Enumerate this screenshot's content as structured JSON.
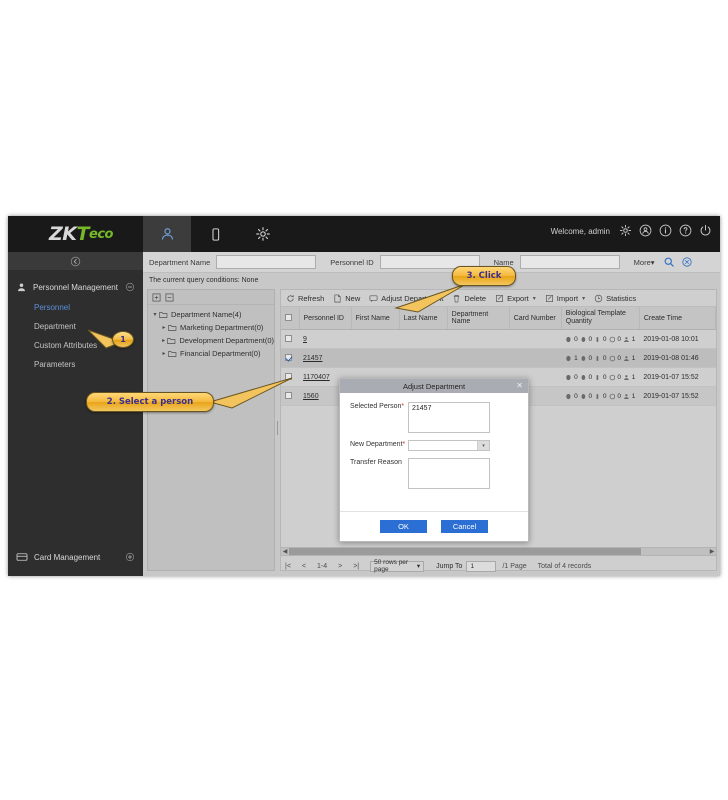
{
  "app": {
    "logo_zk": "ZK",
    "logo_t": "T",
    "logo_eco": "eco",
    "welcome": "Welcome, admin"
  },
  "header": {
    "module_tabs": [
      {
        "name": "personnel",
        "icon": "person-icon",
        "active": true
      },
      {
        "name": "device",
        "icon": "device-icon",
        "active": false
      },
      {
        "name": "settings",
        "icon": "gear-icon",
        "active": false
      }
    ],
    "icons": [
      {
        "name": "gear-icon"
      },
      {
        "name": "user-circle-icon"
      },
      {
        "name": "info-icon"
      },
      {
        "name": "help-icon"
      },
      {
        "name": "power-icon"
      }
    ]
  },
  "sidebar": {
    "collapse_icon": "chevron-left-icon",
    "group": {
      "label": "Personnel Management",
      "icon": "person-icon",
      "toggle": "minus-icon"
    },
    "items": [
      {
        "label": "Personnel",
        "active": true
      },
      {
        "label": "Department",
        "active": false
      },
      {
        "label": "Custom Attributes",
        "active": false
      },
      {
        "label": "Parameters",
        "active": false
      }
    ],
    "bottom_group": {
      "label": "Card Management",
      "icon": "card-icon",
      "toggle": "plus-icon"
    }
  },
  "filters": {
    "fields": [
      {
        "label": "Department Name",
        "value": "",
        "placeholder": ""
      },
      {
        "label": "Personnel ID",
        "value": "",
        "placeholder": ""
      },
      {
        "label": "Name",
        "value": "",
        "placeholder": ""
      }
    ],
    "more_label": "More",
    "search_icon": "search-icon",
    "clear_icon": "clear-circle-icon",
    "query_conditions": "The current query conditions: None"
  },
  "tree": {
    "tools": [
      {
        "name": "expand-all-icon"
      },
      {
        "name": "collapse-all-icon"
      }
    ],
    "nodes": [
      {
        "label": "Department Name(4)",
        "level": 0,
        "expanded": true
      },
      {
        "label": "Marketing Department(0)",
        "level": 1,
        "expanded": false
      },
      {
        "label": "Development Department(0)",
        "level": 1,
        "expanded": false
      },
      {
        "label": "Financial Department(0)",
        "level": 1,
        "expanded": false
      }
    ]
  },
  "toolbar": {
    "buttons": [
      {
        "label": "Refresh",
        "icon": "refresh-icon",
        "caret": false
      },
      {
        "label": "New",
        "icon": "new-icon",
        "caret": false
      },
      {
        "label": "Adjust Department",
        "icon": "adjust-department-icon",
        "caret": false
      },
      {
        "label": "Delete",
        "icon": "delete-icon",
        "caret": false
      },
      {
        "label": "Export",
        "icon": "export-icon",
        "caret": true
      },
      {
        "label": "Import",
        "icon": "import-icon",
        "caret": true
      },
      {
        "label": "Statistics",
        "icon": "statistics-icon",
        "caret": false
      }
    ]
  },
  "table": {
    "columns": [
      "Personnel ID",
      "First Name",
      "Last Name",
      "Department Name",
      "Card Number",
      "Biological Template Quantity",
      "Create Time"
    ],
    "rows": [
      {
        "checked": false,
        "personnel_id": "9",
        "first_name": "",
        "last_name": "",
        "department_name": "",
        "card_number": "",
        "bio": [
          "0",
          "0",
          "0",
          "0",
          "1"
        ],
        "create_time": "2019-01-08 10:01"
      },
      {
        "checked": true,
        "personnel_id": "21457",
        "first_name": "",
        "last_name": "",
        "department_name": "",
        "card_number": "",
        "bio": [
          "1",
          "0",
          "0",
          "0",
          "1"
        ],
        "create_time": "2019-01-08 01:46"
      },
      {
        "checked": false,
        "personnel_id": "1170407",
        "first_name": "",
        "last_name": "",
        "department_name": "",
        "card_number": "",
        "bio": [
          "0",
          "0",
          "0",
          "0",
          "1"
        ],
        "create_time": "2019-01-07 15:52"
      },
      {
        "checked": false,
        "personnel_id": "1560",
        "first_name": "",
        "last_name": "",
        "department_name": "",
        "card_number": "",
        "bio": [
          "0",
          "0",
          "0",
          "0",
          "1"
        ],
        "create_time": "2019-01-07 15:52"
      }
    ]
  },
  "pager": {
    "first_icon": "|<",
    "prev_icon": "<",
    "range": "1-4",
    "next_icon": ">",
    "last_icon": ">|",
    "rows_per_page": "50 rows per page",
    "jump_label": "Jump To",
    "jump_value": "1",
    "page_total": "/1 Page",
    "total_records": "Total of 4 records"
  },
  "dialog": {
    "title": "Adjust Department",
    "close_icon": "close-icon",
    "fields": {
      "selected_person_label": "Selected Person",
      "selected_person_value": "21457",
      "new_department_label": "New Department",
      "new_department_value": "",
      "transfer_reason_label": "Transfer Reason",
      "transfer_reason_value": ""
    },
    "required_mark": "*",
    "ok_label": "OK",
    "cancel_label": "Cancel"
  },
  "callouts": [
    {
      "name": "step-1-badge",
      "text": "1"
    },
    {
      "name": "step-2-bubble",
      "text": "2. Select a person"
    },
    {
      "name": "step-3-bubble",
      "text": "3. Click"
    }
  ],
  "colors": {
    "brand_green": "#76b82a",
    "accent_blue": "#2b6fd4",
    "callout_gold": "#f3bb47",
    "callout_text": "#3c2f8f"
  }
}
